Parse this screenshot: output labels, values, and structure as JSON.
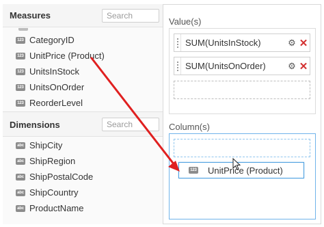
{
  "measures": {
    "title": "Measures",
    "search_placeholder": "Search",
    "items": [
      {
        "badge": "123",
        "label": "CategoryID"
      },
      {
        "badge": "123",
        "label": "UnitPrice (Product)"
      },
      {
        "badge": "123",
        "label": "UnitsInStock"
      },
      {
        "badge": "123",
        "label": "UnitsOnOrder"
      },
      {
        "badge": "123",
        "label": "ReorderLevel"
      }
    ]
  },
  "dimensions": {
    "title": "Dimensions",
    "search_placeholder": "Search",
    "items": [
      {
        "badge": "abc",
        "label": "ShipCity"
      },
      {
        "badge": "abc",
        "label": "ShipRegion"
      },
      {
        "badge": "abc",
        "label": "ShipPostalCode"
      },
      {
        "badge": "abc",
        "label": "ShipCountry"
      },
      {
        "badge": "abc",
        "label": "ProductName"
      }
    ]
  },
  "values": {
    "title": "Value(s)",
    "pills": [
      {
        "label": "SUM(UnitsInStock)"
      },
      {
        "label": "SUM(UnitsOnOrder)"
      }
    ]
  },
  "columns": {
    "title": "Column(s)",
    "dragging": {
      "badge": "123",
      "label": "UnitPrice (Product)"
    }
  },
  "colors": {
    "arrow": "#e02020",
    "close": "#d32f2f",
    "drag_border": "#4a9fe0"
  },
  "icons": {
    "gear": "gear-icon",
    "close": "close-icon",
    "cursor": "mouse-cursor-icon",
    "arrow": "annotation-arrow"
  }
}
